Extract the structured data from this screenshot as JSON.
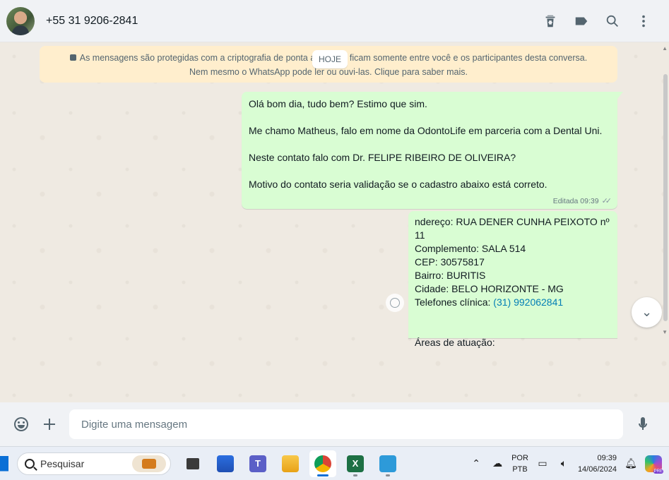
{
  "header": {
    "contact_name": "+55 31 9206-2841",
    "icons": [
      "delete-icon",
      "label-icon",
      "search-icon",
      "menu-icon"
    ]
  },
  "chat": {
    "encryption_notice": "As mensagens são protegidas com a criptografia de ponta a ponta e ficam somente entre você e os participantes desta conversa. Nem mesmo o WhatsApp pode ler ou ouvi-las. Clique para saber mais.",
    "date_chip": "HOJE",
    "message1": {
      "lines": [
        "Olá bom dia, tudo bem? Estimo que sim.",
        "Me chamo Matheus, falo em nome da OdontoLife em parceria com a Dental Uni.",
        "Neste contato falo com Dr. FELIPE RIBEIRO DE OLIVEIRA?",
        "Motivo do contato seria validação se o cadastro abaixo está correto."
      ],
      "meta": "Editada 09:39"
    },
    "message2": {
      "lines": [
        "ndereço: RUA DENER CUNHA PEIXOTO nº 11",
        "Complemento: SALA 514",
        "CEP: 30575817",
        "Bairro: BURITIS",
        "Cidade: BELO HORIZONTE - MG"
      ],
      "phone_label": "Telefones clínica: ",
      "phone_link": "(31) 992062841",
      "areas_label": "Áreas de atuação:"
    }
  },
  "composer": {
    "placeholder": "Digite uma mensagem"
  },
  "taskbar": {
    "search_label": "Pesquisar",
    "lang_line1": "POR",
    "lang_line2": "PTB",
    "time": "09:39",
    "date": "14/06/2024",
    "copilot_badge": "PRE"
  }
}
